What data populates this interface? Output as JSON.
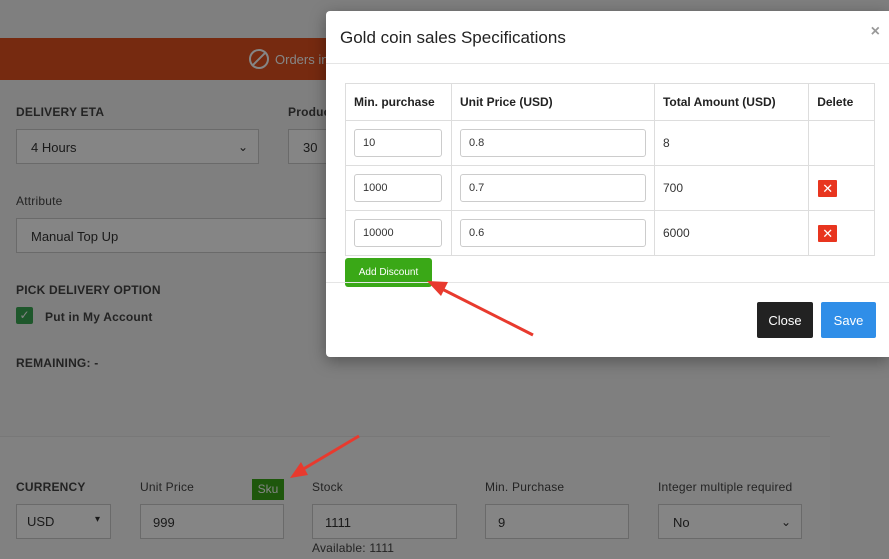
{
  "topbar": {
    "notice": "Orders in",
    "bg": "#e2511f"
  },
  "form": {
    "delivery_eta_label": "DELIVERY ETA",
    "delivery_eta_value": "4 Hours",
    "product_label": "Produc",
    "product_value": "30",
    "attribute_label": "Attribute",
    "attribute_value": "Manual Top Up",
    "pick_delivery_label": "PICK DELIVERY OPTION",
    "put_in_account_label": "Put in My Account",
    "remaining_label": "REMAINING: -"
  },
  "pricing": {
    "currency_label": "CURRENCY",
    "currency_value": "USD",
    "unit_price_label": "Unit Price",
    "sku_tag": "Sku",
    "unit_price_value": "999",
    "stock_label": "Stock",
    "stock_value": "1111",
    "available": "Available: 1111",
    "min_purchase_label": "Min. Purchase",
    "min_purchase_value": "9",
    "integer_multiple_label": "Integer multiple required",
    "integer_multiple_value": "No"
  },
  "modal": {
    "title": "Gold coin sales Specifications",
    "close_glyph": "×",
    "columns": [
      "Min. purchase",
      "Unit Price (USD)",
      "Total Amount (USD)",
      "Delete"
    ],
    "rows": [
      {
        "min": "10",
        "price": "0.8",
        "total": "8",
        "deletable": false
      },
      {
        "min": "1000",
        "price": "0.7",
        "total": "700",
        "deletable": true
      },
      {
        "min": "10000",
        "price": "0.6",
        "total": "6000",
        "deletable": true
      }
    ],
    "delete_glyph": "✕",
    "add_discount_label": "Add Discount",
    "close_label": "Close",
    "save_label": "Save"
  },
  "colors": {
    "accent_green": "#3aa817",
    "save_blue": "#2f8ee8",
    "delete_red": "#e8351f",
    "arrow_red": "#e83a2e"
  }
}
